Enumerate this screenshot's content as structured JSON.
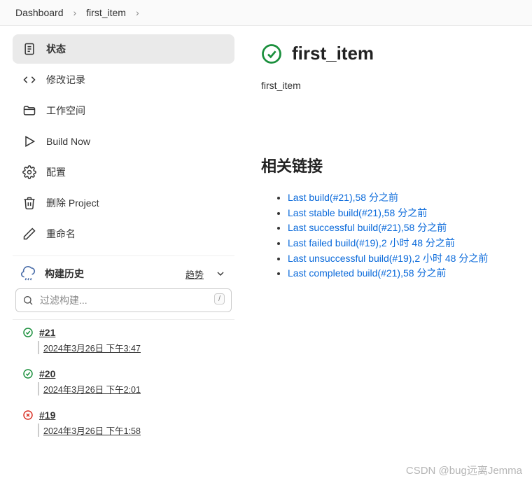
{
  "breadcrumb": [
    {
      "label": "Dashboard"
    },
    {
      "label": "first_item"
    }
  ],
  "sidebar": {
    "items": [
      {
        "label": "状态",
        "icon": "status"
      },
      {
        "label": "修改记录",
        "icon": "changes"
      },
      {
        "label": "工作空间",
        "icon": "workspace"
      },
      {
        "label": "Build Now",
        "icon": "play"
      },
      {
        "label": "配置",
        "icon": "gear"
      },
      {
        "label": "删除 Project",
        "icon": "trash"
      },
      {
        "label": "重命名",
        "icon": "pencil"
      }
    ]
  },
  "history": {
    "title": "构建历史",
    "trend_label": "趋势",
    "search_placeholder": "过滤构建...",
    "builds": [
      {
        "num": "#21",
        "date": "2024年3月26日 下午3:47",
        "status": "success"
      },
      {
        "num": "#20",
        "date": "2024年3月26日 下午2:01",
        "status": "success"
      },
      {
        "num": "#19",
        "date": "2024年3月26日 下午1:58",
        "status": "failed"
      }
    ]
  },
  "main": {
    "title": "first_item",
    "desc": "first_item",
    "links_heading": "相关链接",
    "links": [
      "Last build(#21),58 分之前",
      "Last stable build(#21),58 分之前",
      "Last successful build(#21),58 分之前",
      "Last failed build(#19),2 小时 48 分之前",
      "Last unsuccessful build(#19),2 小时 48 分之前",
      "Last completed build(#21),58 分之前"
    ]
  },
  "watermark": "CSDN @bug远离Jemma"
}
